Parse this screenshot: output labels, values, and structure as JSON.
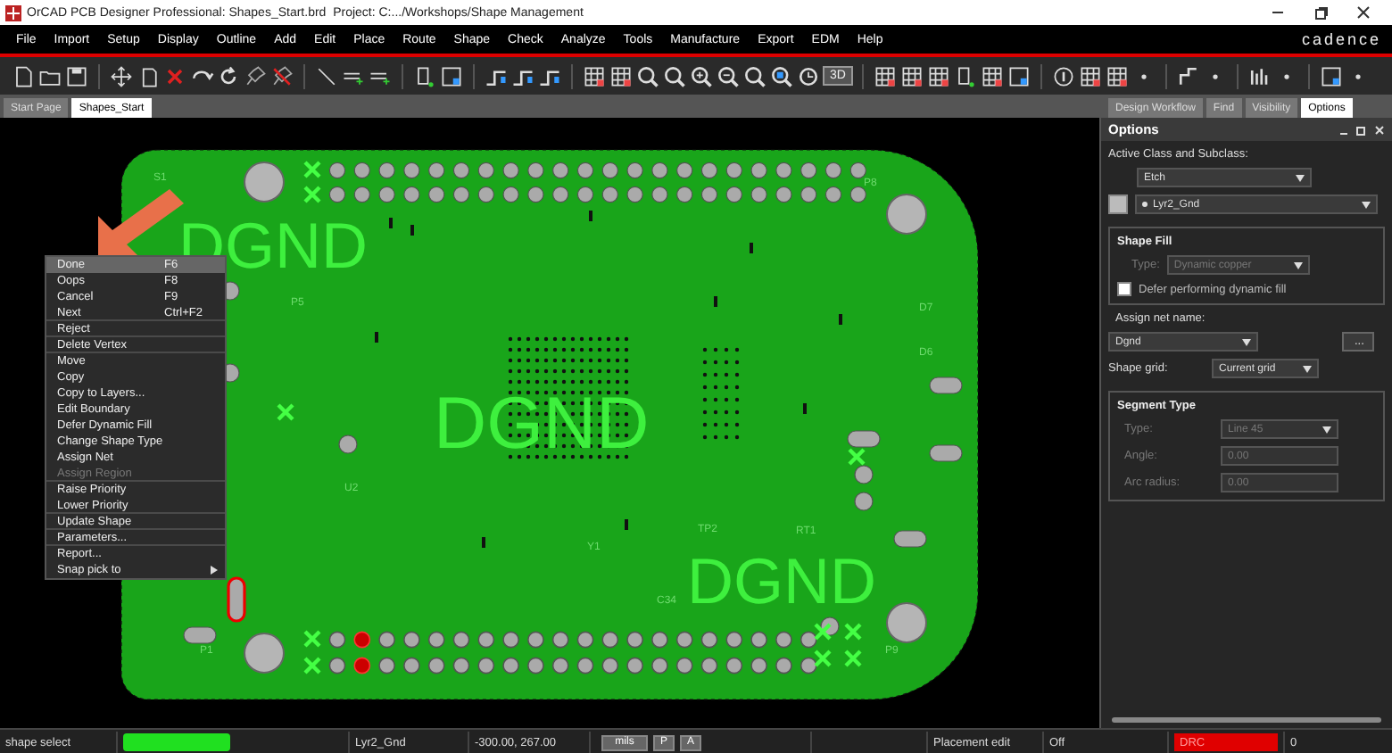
{
  "window": {
    "title": "OrCAD PCB Designer Professional: Shapes_Start.brd  Project: C:.../Workshops/Shape Management"
  },
  "menu_bar": {
    "items": [
      "File",
      "Import",
      "Setup",
      "Display",
      "Outline",
      "Add",
      "Edit",
      "Place",
      "Route",
      "Shape",
      "Check",
      "Analyze",
      "Tools",
      "Manufacture",
      "Export",
      "EDM",
      "Help"
    ],
    "logo": "cadence"
  },
  "toolbar": {
    "view_3d_label": "3D"
  },
  "document_tabs": [
    {
      "label": "Start Page",
      "selected": false
    },
    {
      "label": "Shapes_Start",
      "selected": true
    }
  ],
  "panel_tabs": [
    {
      "label": "Design Workflow",
      "selected": false
    },
    {
      "label": "Find",
      "selected": false
    },
    {
      "label": "Visibility",
      "selected": false
    },
    {
      "label": "Options",
      "selected": true
    }
  ],
  "board": {
    "net_labels": [
      "DGND",
      "DGND",
      "DGND"
    ],
    "silkscreen_labels": [
      "S1",
      "P8",
      "P5",
      "U2",
      "Y1",
      "RT1",
      "D7",
      "D6",
      "C34",
      "P1",
      "P9",
      "TP2"
    ]
  },
  "context_menu": {
    "items": [
      {
        "label": "Done",
        "shortcut": "F6",
        "selected": true,
        "disabled": false,
        "submenu": false,
        "separator_after": false
      },
      {
        "label": "Oops",
        "shortcut": "F8",
        "selected": false,
        "disabled": false,
        "submenu": false,
        "separator_after": false
      },
      {
        "label": "Cancel",
        "shortcut": "F9",
        "selected": false,
        "disabled": false,
        "submenu": false,
        "separator_after": false
      },
      {
        "label": "Next",
        "shortcut": "Ctrl+F2",
        "selected": false,
        "disabled": false,
        "submenu": false,
        "separator_after": true
      },
      {
        "label": "Reject",
        "selected": false,
        "disabled": false,
        "submenu": false,
        "separator_after": true
      },
      {
        "label": "Delete Vertex",
        "selected": false,
        "disabled": false,
        "submenu": false,
        "separator_after": true
      },
      {
        "label": "Move",
        "selected": false,
        "disabled": false,
        "submenu": false,
        "separator_after": false
      },
      {
        "label": "Copy",
        "selected": false,
        "disabled": false,
        "submenu": false,
        "separator_after": false
      },
      {
        "label": "Copy to Layers...",
        "selected": false,
        "disabled": false,
        "submenu": false,
        "separator_after": false
      },
      {
        "label": "Edit Boundary",
        "selected": false,
        "disabled": false,
        "submenu": false,
        "separator_after": false
      },
      {
        "label": "Defer Dynamic Fill",
        "selected": false,
        "disabled": false,
        "submenu": false,
        "separator_after": false
      },
      {
        "label": "Change Shape Type",
        "selected": false,
        "disabled": false,
        "submenu": false,
        "separator_after": false
      },
      {
        "label": "Assign Net",
        "selected": false,
        "disabled": false,
        "submenu": false,
        "separator_after": false
      },
      {
        "label": "Assign Region",
        "selected": false,
        "disabled": true,
        "submenu": false,
        "separator_after": true
      },
      {
        "label": "Raise Priority",
        "selected": false,
        "disabled": false,
        "submenu": false,
        "separator_after": false
      },
      {
        "label": "Lower Priority",
        "selected": false,
        "disabled": false,
        "submenu": false,
        "separator_after": true
      },
      {
        "label": "Update Shape",
        "selected": false,
        "disabled": false,
        "submenu": false,
        "separator_after": true
      },
      {
        "label": "Parameters...",
        "selected": false,
        "disabled": false,
        "submenu": false,
        "separator_after": true
      },
      {
        "label": "Report...",
        "selected": false,
        "disabled": false,
        "submenu": false,
        "separator_after": false
      },
      {
        "label": "Snap pick to",
        "selected": false,
        "disabled": false,
        "submenu": true,
        "separator_after": false
      }
    ]
  },
  "options_panel": {
    "title": "Options",
    "class_label": "Active Class and Subclass:",
    "class_value": "Etch",
    "subclass_value": "Lyr2_Gnd",
    "shape_fill": {
      "title": "Shape Fill",
      "type_label": "Type:",
      "type_value": "Dynamic copper",
      "type_disabled": true,
      "defer_label": "Defer performing dynamic fill",
      "defer_checked": false
    },
    "net_label": "Assign net name:",
    "net_value": "Dgnd",
    "browse_button": "...",
    "grid_label": "Shape grid:",
    "grid_value": "Current grid",
    "segment_type": {
      "title": "Segment Type",
      "fields": [
        {
          "label": "Type:",
          "value": "Line 45",
          "kind": "dropdown",
          "disabled": true
        },
        {
          "label": "Angle:",
          "value": "0.00",
          "kind": "text",
          "disabled": true
        },
        {
          "label": "Arc radius:",
          "value": "0.00",
          "kind": "text",
          "disabled": true
        }
      ]
    }
  },
  "status_bar": {
    "command": "shape select",
    "subclass": "Lyr2_Gnd",
    "coordinates": "-300.00, 267.00",
    "units_button": "mils",
    "p_button": "P",
    "a_button": "A",
    "mode": "Placement edit",
    "state": "Off",
    "drc_label": "DRC",
    "drc_count": "0"
  }
}
